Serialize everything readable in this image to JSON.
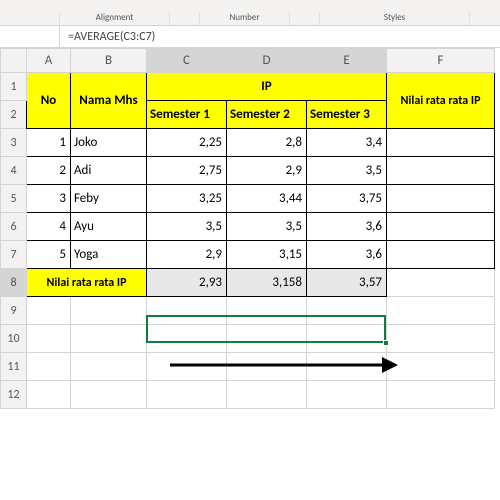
{
  "ribbon": {
    "g1": "",
    "g2": "Alignment",
    "g3": "",
    "g4": "Number",
    "g5": "",
    "g6": "Styles"
  },
  "fx": {
    "formula": "=AVERAGE(C3:C7)"
  },
  "cols": {
    "A": "A",
    "B": "B",
    "C": "C",
    "D": "D",
    "E": "E",
    "F": "F"
  },
  "rows": {
    "r1": "1",
    "r2": "2",
    "r3": "3",
    "r4": "4",
    "r5": "5",
    "r6": "6",
    "r7": "7",
    "r8": "8",
    "r9": "9",
    "r10": "10",
    "r11": "11",
    "r12": "12"
  },
  "hdr": {
    "no": "No",
    "nama": "Nama Mhs",
    "ip": "IP",
    "s1": "Semester 1",
    "s2": "Semester 2",
    "s3": "Semester 3",
    "nilai": "Nilai rata rata IP"
  },
  "data": {
    "r3": {
      "no": "1",
      "nama": "Joko",
      "s1": "2,25",
      "s2": "2,8",
      "s3": "3,4"
    },
    "r4": {
      "no": "2",
      "nama": "Adi",
      "s1": "2,75",
      "s2": "2,9",
      "s3": "3,5"
    },
    "r5": {
      "no": "3",
      "nama": "Feby",
      "s1": "3,25",
      "s2": "3,44",
      "s3": "3,75"
    },
    "r6": {
      "no": "4",
      "nama": "Ayu",
      "s1": "3,5",
      "s2": "3,5",
      "s3": "3,6"
    },
    "r7": {
      "no": "5",
      "nama": "Yoga",
      "s1": "2,9",
      "s2": "3,15",
      "s3": "3,6"
    },
    "r8": {
      "label": "Nilai rata rata IP",
      "s1": "2,93",
      "s2": "3,158",
      "s3": "3,57"
    }
  },
  "chart_data": {
    "type": "table",
    "title": "IP",
    "columns": [
      "No",
      "Nama Mhs",
      "Semester 1",
      "Semester 2",
      "Semester 3"
    ],
    "rows": [
      [
        1,
        "Joko",
        2.25,
        2.8,
        3.4
      ],
      [
        2,
        "Adi",
        2.75,
        2.9,
        3.5
      ],
      [
        3,
        "Feby",
        3.25,
        3.44,
        3.75
      ],
      [
        4,
        "Ayu",
        3.5,
        3.5,
        3.6
      ],
      [
        5,
        "Yoga",
        2.9,
        3.15,
        3.6
      ]
    ],
    "summary_row": {
      "label": "Nilai rata rata IP",
      "values": [
        2.93,
        3.158,
        3.57
      ]
    }
  }
}
